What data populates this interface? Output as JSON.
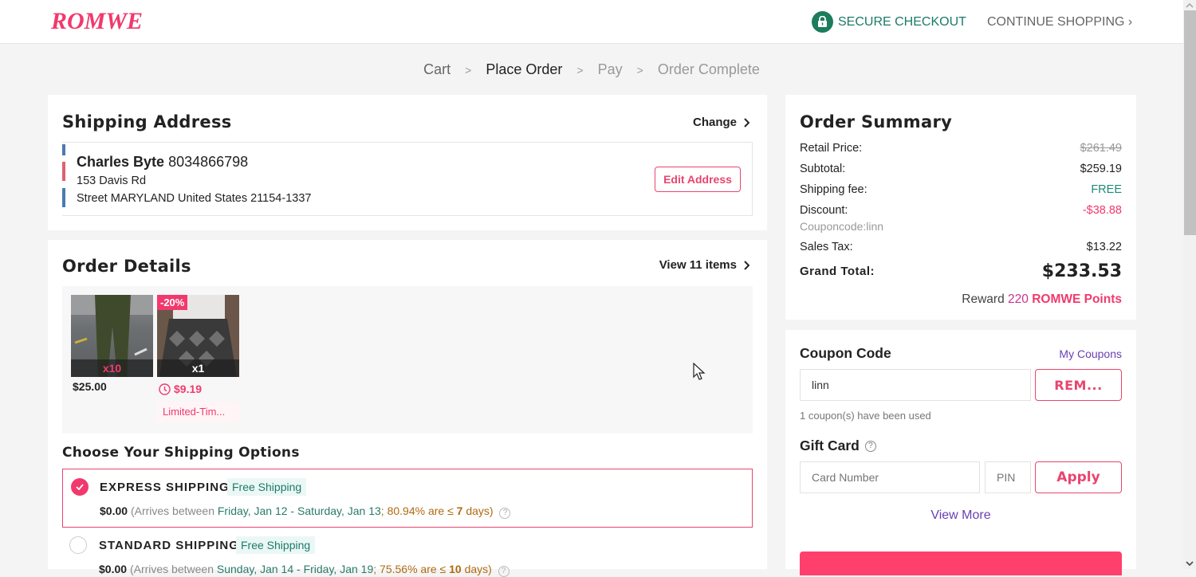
{
  "header": {
    "logo": "ROMWE",
    "secure_checkout": "SECURE CHECKOUT",
    "continue_shopping": "CONTINUE SHOPPING ›"
  },
  "breadcrumb": {
    "steps": [
      "Cart",
      "Place Order",
      "Pay",
      "Order Complete"
    ],
    "separator": ">",
    "active": "Place Order"
  },
  "shipping_address": {
    "title": "Shipping Address",
    "change_label": "Change",
    "name": "Charles Byte",
    "phone": "8034866798",
    "line1": "153 Davis Rd",
    "line2": "Street MARYLAND United States 21154-1337",
    "edit_label": "Edit Address"
  },
  "order_details": {
    "title": "Order Details",
    "view_items": "View 11 items",
    "items": [
      {
        "qty": "x10",
        "price": "$25.00",
        "discount_badge": "",
        "tag": ""
      },
      {
        "qty": "x1",
        "price": "$9.19",
        "discount_badge": "-20%",
        "tag": "Limited-Tim..."
      }
    ]
  },
  "shipping_options": {
    "title": "Choose Your Shipping Options",
    "options": [
      {
        "name": "EXPRESS SHIPPING",
        "tag": "Free Shipping",
        "selected": true,
        "price": "$0.00",
        "arrives_prefix": "(Arrives between ",
        "dates": "Friday, Jan 12 - Saturday, Jan 13",
        "stat_pre": "; 80.94% are ≤ ",
        "days": "7",
        "stat_post": " days)"
      },
      {
        "name": "STANDARD SHIPPING",
        "tag": "Free Shipping",
        "selected": false,
        "price": "$0.00",
        "arrives_prefix": "(Arrives between ",
        "dates": "Sunday, Jan 14 - Friday, Jan 19",
        "stat_pre": "; 75.56% are ≤ ",
        "days": "10",
        "stat_post": " days)"
      }
    ]
  },
  "order_summary": {
    "title": "Order Summary",
    "retail_label": "Retail Price:",
    "retail_value": "$261.49",
    "subtotal_label": "Subtotal:",
    "subtotal_value": "$259.19",
    "shipping_label": "Shipping fee:",
    "shipping_value": "FREE",
    "discount_label": "Discount:",
    "discount_value": "-$38.88",
    "coupon_note": "Couponcode:linn",
    "tax_label": "Sales Tax:",
    "tax_value": "$13.22",
    "total_label": "Grand Total:",
    "total_value": "$233.53",
    "reward_prefix": "Reward ",
    "reward_points": "220",
    "reward_suffix": "ROMWE Points"
  },
  "coupon": {
    "title": "Coupon Code",
    "my_coupons": "My Coupons",
    "value": "linn",
    "remove_label": "REM...",
    "used_note": "1 coupon(s) have been used"
  },
  "gift_card": {
    "title": "Gift Card",
    "card_placeholder": "Card Number",
    "pin_placeholder": "PIN",
    "apply_label": "Apply",
    "view_more": "View More"
  },
  "colors": {
    "brand": "#f1396d",
    "teal": "#1b7d5c",
    "purple_link": "#6a3fb5"
  }
}
